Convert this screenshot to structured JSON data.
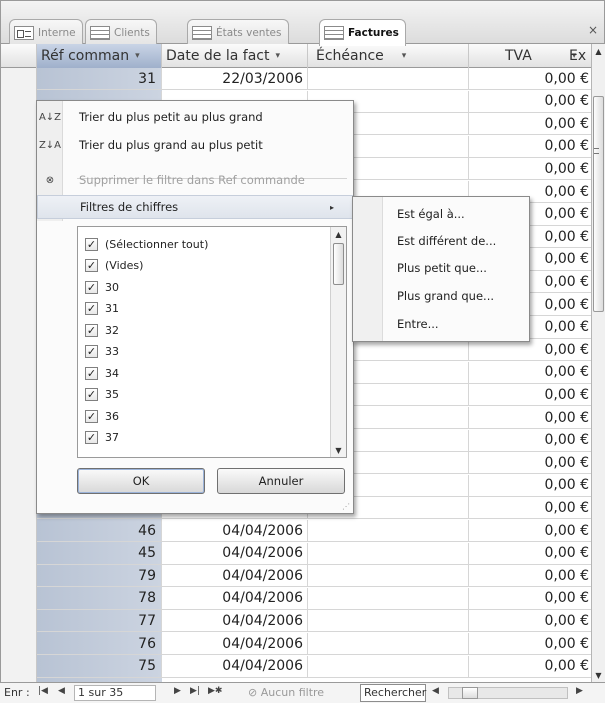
{
  "tabs": [
    {
      "label": "Interne",
      "icon": "form-icon",
      "active": false
    },
    {
      "label": "Clients",
      "icon": "table-icon",
      "active": false
    },
    {
      "label": "États ventes",
      "icon": "table-icon",
      "active": false
    },
    {
      "label": "Factures",
      "icon": "table-icon",
      "active": true
    }
  ],
  "close_label": "×",
  "columns": [
    {
      "label": "Réf comman",
      "arrow": "▾"
    },
    {
      "label": "Date de la fact",
      "arrow": "▾"
    },
    {
      "label": "Échéance",
      "arrow": "▾"
    },
    {
      "label": "TVA",
      "arrow": "▾"
    },
    {
      "label": "Ex",
      "arrow": ""
    }
  ],
  "rows": [
    {
      "ref": "31",
      "date": "22/03/2006",
      "tva": "0,00 €"
    },
    {
      "ref": "",
      "date": "",
      "tva": "0,00 €"
    },
    {
      "ref": "",
      "date": "",
      "tva": "0,00 €"
    },
    {
      "ref": "",
      "date": "",
      "tva": "0,00 €"
    },
    {
      "ref": "",
      "date": "",
      "tva": "0,00 €"
    },
    {
      "ref": "",
      "date": "",
      "tva": "0,00 €"
    },
    {
      "ref": "",
      "date": "",
      "tva": "0,00 €"
    },
    {
      "ref": "",
      "date": "",
      "tva": "0,00 €"
    },
    {
      "ref": "",
      "date": "",
      "tva": "0,00 €"
    },
    {
      "ref": "",
      "date": "",
      "tva": "0,00 €"
    },
    {
      "ref": "",
      "date": "",
      "tva": "0,00 €"
    },
    {
      "ref": "",
      "date": "",
      "tva": "0,00 €"
    },
    {
      "ref": "",
      "date": "",
      "tva": "0,00 €"
    },
    {
      "ref": "",
      "date": "",
      "tva": "0,00 €"
    },
    {
      "ref": "",
      "date": "",
      "tva": "0,00 €"
    },
    {
      "ref": "",
      "date": "",
      "tva": "0,00 €"
    },
    {
      "ref": "",
      "date": "",
      "tva": "0,00 €"
    },
    {
      "ref": "",
      "date": "",
      "tva": "0,00 €"
    },
    {
      "ref": "",
      "date": "",
      "tva": "0,00 €"
    },
    {
      "ref": "",
      "date": "",
      "tva": "0,00 €"
    },
    {
      "ref": "46",
      "date": "04/04/2006",
      "tva": "0,00 €"
    },
    {
      "ref": "45",
      "date": "04/04/2006",
      "tva": "0,00 €"
    },
    {
      "ref": "79",
      "date": "04/04/2006",
      "tva": "0,00 €"
    },
    {
      "ref": "78",
      "date": "04/04/2006",
      "tva": "0,00 €"
    },
    {
      "ref": "77",
      "date": "04/04/2006",
      "tva": "0,00 €"
    },
    {
      "ref": "76",
      "date": "04/04/2006",
      "tva": "0,00 €"
    },
    {
      "ref": "75",
      "date": "04/04/2006",
      "tva": "0,00 €"
    }
  ],
  "filter_menu": {
    "sort_asc": {
      "icon": "A↓Z",
      "label": "Trier du plus petit au plus grand"
    },
    "sort_desc": {
      "icon": "Z↓A",
      "label": "Trier du plus grand au plus petit"
    },
    "clear_filter": {
      "icon": "⊗",
      "label": "Supprimer le filtre dans Ref commande"
    },
    "number_filters": {
      "label": "Filtres de chiffres",
      "arrow": "▸"
    },
    "checklist": [
      {
        "label": "(Sélectionner tout)",
        "checked": true
      },
      {
        "label": "(Vides)",
        "checked": true
      },
      {
        "label": "30",
        "checked": true
      },
      {
        "label": "31",
        "checked": true
      },
      {
        "label": "32",
        "checked": true
      },
      {
        "label": "33",
        "checked": true
      },
      {
        "label": "34",
        "checked": true
      },
      {
        "label": "35",
        "checked": true
      },
      {
        "label": "36",
        "checked": true
      },
      {
        "label": "37",
        "checked": true
      }
    ],
    "ok_label": "OK",
    "cancel_label": "Annuler"
  },
  "number_submenu": [
    "Est égal à...",
    "Est différent de...",
    "Plus petit que...",
    "Plus grand que...",
    "Entre..."
  ],
  "navbar": {
    "record_label": "Enr :",
    "record_value": "1 sur 35",
    "filter_status": "Aucun filtre",
    "search_label": "Rechercher"
  }
}
